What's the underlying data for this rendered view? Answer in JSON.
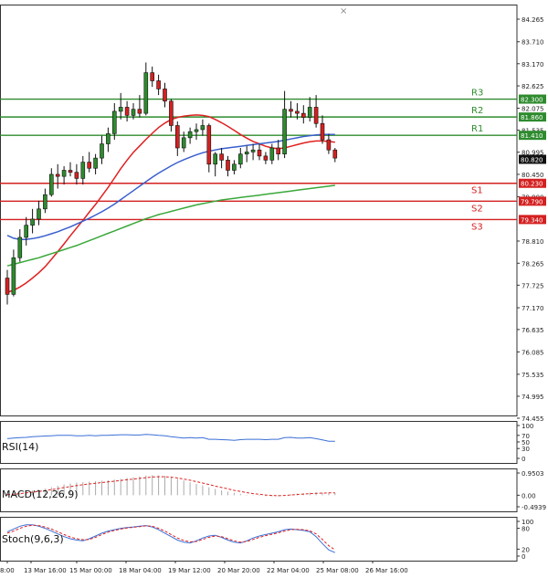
{
  "chart_data": {
    "type": "candlestick",
    "title": "",
    "main": {
      "y_ticks": [
        "84.265",
        "83.710",
        "83.170",
        "82.625",
        "82.075",
        "81.535",
        "80.995",
        "80.450",
        "79.900",
        "78.810",
        "78.265",
        "77.725",
        "77.170",
        "76.635",
        "76.085",
        "75.535",
        "74.995",
        "74.455"
      ],
      "ylim": [
        74.455,
        84.5
      ],
      "levels": [
        {
          "name": "R3",
          "value": 82.3,
          "tag": "82.300",
          "color": "#2e8b2e",
          "role": "resistance"
        },
        {
          "name": "R2",
          "value": 81.86,
          "tag": "81.860",
          "color": "#2e8b2e",
          "role": "resistance"
        },
        {
          "name": "R1",
          "value": 81.41,
          "tag": "81.410",
          "color": "#2e8b2e",
          "role": "resistance"
        },
        {
          "name": "S1",
          "value": 80.23,
          "tag": "80.230",
          "color": "#d42020",
          "role": "support"
        },
        {
          "name": "S2",
          "value": 79.79,
          "tag": "79.790",
          "color": "#d42020",
          "role": "support"
        },
        {
          "name": "S3",
          "value": 79.34,
          "tag": "79.340",
          "color": "#d42020",
          "role": "support"
        }
      ],
      "current_price": "80.820",
      "candles": [
        [
          77.9,
          78.1,
          77.25,
          77.5
        ],
        [
          77.5,
          78.6,
          77.45,
          78.4
        ],
        [
          78.4,
          79.1,
          78.3,
          78.9
        ],
        [
          78.9,
          79.4,
          78.7,
          79.2
        ],
        [
          79.2,
          79.6,
          79.0,
          79.35
        ],
        [
          79.35,
          79.8,
          79.2,
          79.6
        ],
        [
          79.6,
          80.1,
          79.5,
          79.95
        ],
        [
          79.95,
          80.6,
          79.9,
          80.45
        ],
        [
          80.45,
          80.7,
          80.1,
          80.4
        ],
        [
          80.4,
          80.65,
          80.2,
          80.55
        ],
        [
          80.55,
          80.75,
          80.4,
          80.5
        ],
        [
          80.5,
          80.7,
          80.2,
          80.35
        ],
        [
          80.35,
          80.9,
          80.2,
          80.75
        ],
        [
          80.75,
          81.0,
          80.5,
          80.6
        ],
        [
          80.6,
          80.95,
          80.45,
          80.85
        ],
        [
          80.85,
          81.4,
          80.7,
          81.2
        ],
        [
          81.2,
          81.6,
          81.0,
          81.45
        ],
        [
          81.45,
          82.2,
          81.3,
          82.0
        ],
        [
          82.0,
          82.45,
          81.8,
          82.1
        ],
        [
          82.1,
          82.25,
          81.75,
          81.9
        ],
        [
          81.9,
          82.2,
          81.8,
          82.05
        ],
        [
          82.05,
          82.4,
          81.85,
          81.95
        ],
        [
          81.95,
          83.2,
          81.9,
          82.95
        ],
        [
          82.95,
          83.1,
          82.6,
          82.75
        ],
        [
          82.75,
          82.9,
          82.4,
          82.55
        ],
        [
          82.55,
          82.7,
          82.1,
          82.25
        ],
        [
          82.25,
          82.3,
          81.5,
          81.65
        ],
        [
          81.65,
          81.75,
          80.9,
          81.1
        ],
        [
          81.1,
          81.5,
          81.0,
          81.35
        ],
        [
          81.35,
          81.6,
          81.2,
          81.5
        ],
        [
          81.5,
          81.7,
          81.3,
          81.55
        ],
        [
          81.55,
          81.8,
          81.4,
          81.65
        ],
        [
          81.65,
          81.7,
          80.5,
          80.7
        ],
        [
          80.7,
          81.0,
          80.4,
          80.95
        ],
        [
          80.95,
          81.1,
          80.6,
          80.8
        ],
        [
          80.8,
          80.9,
          80.4,
          80.55
        ],
        [
          80.55,
          80.8,
          80.45,
          80.7
        ],
        [
          80.7,
          81.1,
          80.6,
          80.95
        ],
        [
          80.95,
          81.15,
          80.75,
          81.0
        ],
        [
          81.0,
          81.2,
          80.8,
          81.05
        ],
        [
          81.05,
          81.2,
          80.8,
          80.9
        ],
        [
          80.9,
          81.0,
          80.7,
          80.8
        ],
        [
          80.8,
          81.2,
          80.7,
          81.1
        ],
        [
          81.1,
          81.3,
          80.8,
          80.95
        ],
        [
          80.95,
          82.5,
          80.85,
          82.05
        ],
        [
          82.05,
          82.25,
          81.85,
          82.0
        ],
        [
          82.0,
          82.2,
          81.8,
          81.95
        ],
        [
          81.95,
          82.15,
          81.7,
          81.85
        ],
        [
          81.85,
          82.35,
          81.75,
          82.1
        ],
        [
          82.1,
          82.4,
          81.6,
          81.7
        ],
        [
          81.7,
          81.9,
          81.2,
          81.3
        ],
        [
          81.3,
          81.45,
          80.95,
          81.05
        ],
        [
          81.05,
          81.1,
          80.75,
          80.85
        ]
      ],
      "moving_averages": [
        {
          "name": "MA red",
          "color": "#e02020",
          "values": [
            77.55,
            77.6,
            77.68,
            77.78,
            77.9,
            78.03,
            78.18,
            78.36,
            78.55,
            78.74,
            78.94,
            79.13,
            79.32,
            79.52,
            79.71,
            79.92,
            80.13,
            80.36,
            80.59,
            80.8,
            80.99,
            81.15,
            81.31,
            81.46,
            81.6,
            81.71,
            81.8,
            81.85,
            81.88,
            81.9,
            81.91,
            81.9,
            81.87,
            81.8,
            81.72,
            81.63,
            81.53,
            81.43,
            81.34,
            81.26,
            81.2,
            81.14,
            81.1,
            81.08,
            81.1,
            81.14,
            81.18,
            81.22,
            81.25,
            81.27,
            81.27,
            81.26,
            81.24
          ]
        },
        {
          "name": "MA blue",
          "color": "#3a5fcd",
          "values": [
            78.95,
            78.88,
            78.85,
            78.85,
            78.87,
            78.9,
            78.94,
            78.99,
            79.04,
            79.1,
            79.16,
            79.23,
            79.3,
            79.37,
            79.45,
            79.53,
            79.62,
            79.72,
            79.83,
            79.94,
            80.05,
            80.16,
            80.27,
            80.38,
            80.48,
            80.57,
            80.66,
            80.74,
            80.81,
            80.87,
            80.93,
            80.98,
            81.02,
            81.05,
            81.08,
            81.1,
            81.12,
            81.14,
            81.16,
            81.18,
            81.2,
            81.22,
            81.24,
            81.26,
            81.29,
            81.32,
            81.35,
            81.38,
            81.4,
            81.42,
            81.43,
            81.43,
            81.43
          ]
        },
        {
          "name": "MA green",
          "color": "#3aa83a",
          "values": [
            78.2,
            78.24,
            78.28,
            78.32,
            78.36,
            78.4,
            78.45,
            78.5,
            78.55,
            78.6,
            78.65,
            78.7,
            78.76,
            78.82,
            78.88,
            78.94,
            79.0,
            79.06,
            79.12,
            79.18,
            79.24,
            79.3,
            79.36,
            79.41,
            79.46,
            79.5,
            79.54,
            79.58,
            79.62,
            79.66,
            79.7,
            79.73,
            79.76,
            79.79,
            79.82,
            79.84,
            79.86,
            79.88,
            79.9,
            79.92,
            79.94,
            79.96,
            79.98,
            80.0,
            80.02,
            80.04,
            80.06,
            80.08,
            80.1,
            80.12,
            80.14,
            80.16,
            80.18
          ]
        }
      ]
    },
    "x_ticks": [
      "8:00",
      "13 Mar 16:00",
      "15 Mar 00:00",
      "18 Mar 04:00",
      "19 Mar 12:00",
      "20 Mar 20:00",
      "22 Mar 04:00",
      "25 Mar 08:00",
      "26 Mar 16:00"
    ],
    "indicators": [
      {
        "name": "RSI(14)",
        "ticks": [
          "100",
          "70",
          "50",
          "30",
          "0"
        ],
        "range": [
          0,
          100
        ],
        "series": [
          {
            "color": "#3b6fd6",
            "values": [
              60,
              62,
              63,
              64,
              66,
              67,
              68,
              69,
              70,
              70,
              70,
              69,
              69,
              70,
              69,
              70,
              70,
              71,
              72,
              72,
              71,
              71,
              73,
              72,
              70,
              69,
              66,
              64,
              62,
              63,
              62,
              63,
              58,
              58,
              57,
              56,
              55,
              57,
              58,
              58,
              58,
              57,
              58,
              58,
              63,
              64,
              62,
              62,
              63,
              60,
              56,
              52,
              52
            ]
          }
        ]
      },
      {
        "name": "MACD(12,26,9)",
        "ticks": [
          "0.9503",
          "0.00",
          "-0.4939"
        ],
        "range": [
          -0.4939,
          0.9503
        ],
        "bar_color": "#aaaaaa",
        "histogram": [
          0.05,
          0.08,
          0.12,
          0.16,
          0.2,
          0.24,
          0.28,
          0.34,
          0.4,
          0.46,
          0.5,
          0.54,
          0.56,
          0.58,
          0.6,
          0.62,
          0.64,
          0.67,
          0.7,
          0.74,
          0.77,
          0.8,
          0.84,
          0.86,
          0.85,
          0.83,
          0.78,
          0.71,
          0.63,
          0.55,
          0.48,
          0.42,
          0.34,
          0.27,
          0.21,
          0.15,
          0.1,
          0.06,
          0.02,
          -0.01,
          -0.03,
          -0.04,
          -0.05,
          -0.04,
          0.0,
          0.04,
          0.07,
          0.09,
          0.11,
          0.12,
          0.11,
          0.1,
          0.09
        ],
        "series": [
          {
            "color": "#e02020",
            "dashed": true,
            "values": [
              0.02,
              0.04,
              0.07,
              0.1,
              0.13,
              0.16,
              0.2,
              0.24,
              0.28,
              0.33,
              0.37,
              0.41,
              0.45,
              0.48,
              0.51,
              0.54,
              0.57,
              0.6,
              0.63,
              0.66,
              0.69,
              0.72,
              0.75,
              0.78,
              0.79,
              0.79,
              0.77,
              0.74,
              0.69,
              0.64,
              0.58,
              0.52,
              0.46,
              0.39,
              0.33,
              0.27,
              0.21,
              0.16,
              0.11,
              0.07,
              0.04,
              0.01,
              -0.01,
              -0.02,
              -0.01,
              0.01,
              0.03,
              0.05,
              0.07,
              0.08,
              0.09,
              0.1,
              0.1
            ]
          }
        ]
      },
      {
        "name": "Stoch(9,6,3)",
        "ticks": [
          "100",
          "80",
          "20",
          "0"
        ],
        "range": [
          0,
          100
        ],
        "series": [
          {
            "color": "#3b6fd6",
            "dashed": false,
            "values": [
              70,
              78,
              86,
              90,
              90,
              86,
              80,
              72,
              64,
              56,
              50,
              46,
              44,
              50,
              58,
              66,
              72,
              76,
              80,
              82,
              84,
              86,
              88,
              84,
              76,
              66,
              56,
              46,
              40,
              38,
              44,
              52,
              58,
              60,
              54,
              46,
              40,
              38,
              44,
              52,
              58,
              62,
              66,
              70,
              76,
              78,
              76,
              74,
              70,
              56,
              36,
              18,
              10
            ]
          },
          {
            "color": "#e02020",
            "dashed": true,
            "values": [
              66,
              72,
              80,
              86,
              89,
              88,
              84,
              78,
              70,
              62,
              55,
              50,
              47,
              48,
              54,
              62,
              69,
              74,
              78,
              81,
              83,
              85,
              87,
              86,
              80,
              72,
              62,
              52,
              45,
              41,
              42,
              48,
              54,
              58,
              56,
              50,
              44,
              40,
              42,
              48,
              54,
              59,
              63,
              67,
              72,
              76,
              77,
              76,
              73,
              64,
              48,
              30,
              18
            ]
          }
        ]
      }
    ]
  }
}
